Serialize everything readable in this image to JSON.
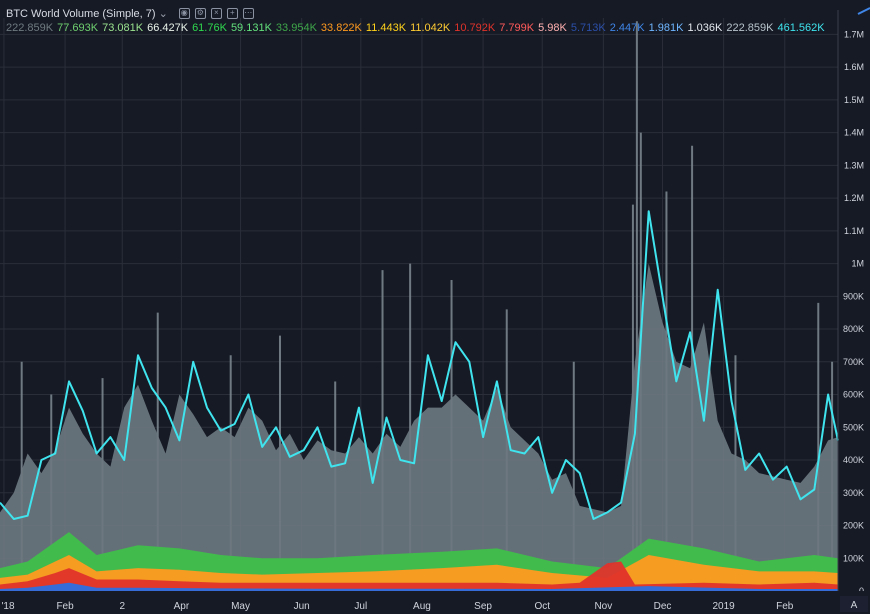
{
  "legend": {
    "title": "BTC World Volume (Simple, 7)",
    "chevron": "⌄",
    "buttons": [
      {
        "icon": "eye-icon",
        "glyph": "◉"
      },
      {
        "icon": "settings-icon",
        "glyph": "⚙"
      },
      {
        "icon": "remove-icon",
        "glyph": "×"
      },
      {
        "icon": "add-icon",
        "glyph": "+"
      },
      {
        "icon": "more-icon",
        "glyph": "⋯"
      }
    ],
    "values": [
      {
        "text": "222.859K",
        "color": "#6f7a80"
      },
      {
        "text": "77.693K",
        "color": "#6fcf6f"
      },
      {
        "text": "73.081K",
        "color": "#9be38f"
      },
      {
        "text": "66.427K",
        "color": "#e8f2e8"
      },
      {
        "text": "61.76K",
        "color": "#2fd94f"
      },
      {
        "text": "59.131K",
        "color": "#63e07c"
      },
      {
        "text": "33.954K",
        "color": "#3fa64a"
      },
      {
        "text": "33.822K",
        "color": "#ff9a1f"
      },
      {
        "text": "11.443K",
        "color": "#ffd21a"
      },
      {
        "text": "11.042K",
        "color": "#ffcc33"
      },
      {
        "text": "10.792K",
        "color": "#e0332b"
      },
      {
        "text": "7.799K",
        "color": "#ff5a5a"
      },
      {
        "text": "5.98K",
        "color": "#ffb0b0"
      },
      {
        "text": "5.713K",
        "color": "#2b4fa8"
      },
      {
        "text": "2.447K",
        "color": "#3f86e8"
      },
      {
        "text": "1.981K",
        "color": "#6fb6ff"
      },
      {
        "text": "1.036K",
        "color": "#e4e8ee"
      },
      {
        "text": "222.859K",
        "color": "#b8c4cc"
      },
      {
        "text": "461.562K",
        "color": "#3fe4ee"
      }
    ]
  },
  "colors": {
    "background": "#161a25",
    "grid": "#2a2e39",
    "total_area": "#6b777f",
    "moving_average": "#3fe4ee",
    "spikes": "#7e8a92"
  },
  "chart_data": {
    "type": "area",
    "title": "BTC World Volume (Simple, 7)",
    "xlabel": "",
    "ylabel": "",
    "ylim": [
      0,
      1750000
    ],
    "grid": true,
    "y_ticks": [
      "0",
      "100K",
      "200K",
      "300K",
      "400K",
      "500K",
      "600K",
      "700K",
      "800K",
      "900K",
      "1M",
      "1.1M",
      "1.2M",
      "1.3M",
      "1.4M",
      "1.5M",
      "1.6M",
      "1.7M"
    ],
    "x_ticks": [
      {
        "label": "'18",
        "x": "2018-01-01"
      },
      {
        "label": "Feb",
        "x": "2018-02-01"
      },
      {
        "label": "2",
        "x": "2018-03-02"
      },
      {
        "label": "Apr",
        "x": "2018-04-01"
      },
      {
        "label": "May",
        "x": "2018-05-01"
      },
      {
        "label": "Jun",
        "x": "2018-06-01"
      },
      {
        "label": "Jul",
        "x": "2018-07-01"
      },
      {
        "label": "Aug",
        "x": "2018-08-01"
      },
      {
        "label": "Sep",
        "x": "2018-09-01"
      },
      {
        "label": "Oct",
        "x": "2018-10-01"
      },
      {
        "label": "Nov",
        "x": "2018-11-01"
      },
      {
        "label": "Dec",
        "x": "2018-12-01"
      },
      {
        "label": "2019",
        "x": "2019-01-01"
      },
      {
        "label": "Feb",
        "x": "2019-02-01"
      }
    ],
    "x_range": [
      "2017-12-30",
      "2019-02-28"
    ],
    "series": [
      {
        "name": "",
        "role": "total",
        "values": [
          [
            "2017-12-30",
            240000
          ],
          [
            "2018-01-06",
            300000
          ],
          [
            "2018-01-13",
            420000
          ],
          [
            "2018-01-20",
            360000
          ],
          [
            "2018-01-27",
            430000
          ],
          [
            "2018-02-03",
            560000
          ],
          [
            "2018-02-10",
            480000
          ],
          [
            "2018-02-17",
            420000
          ],
          [
            "2018-02-24",
            380000
          ],
          [
            "2018-03-03",
            560000
          ],
          [
            "2018-03-10",
            630000
          ],
          [
            "2018-03-17",
            520000
          ],
          [
            "2018-03-24",
            420000
          ],
          [
            "2018-03-31",
            600000
          ],
          [
            "2018-04-07",
            540000
          ],
          [
            "2018-04-14",
            470000
          ],
          [
            "2018-04-21",
            500000
          ],
          [
            "2018-04-28",
            470000
          ],
          [
            "2018-05-05",
            560000
          ],
          [
            "2018-05-12",
            520000
          ],
          [
            "2018-05-19",
            430000
          ],
          [
            "2018-05-26",
            480000
          ],
          [
            "2018-06-02",
            400000
          ],
          [
            "2018-06-09",
            460000
          ],
          [
            "2018-06-16",
            430000
          ],
          [
            "2018-06-23",
            420000
          ],
          [
            "2018-06-30",
            470000
          ],
          [
            "2018-07-07",
            420000
          ],
          [
            "2018-07-14",
            480000
          ],
          [
            "2018-07-21",
            440000
          ],
          [
            "2018-07-28",
            520000
          ],
          [
            "2018-08-04",
            560000
          ],
          [
            "2018-08-11",
            560000
          ],
          [
            "2018-08-18",
            600000
          ],
          [
            "2018-08-25",
            560000
          ],
          [
            "2018-09-01",
            520000
          ],
          [
            "2018-09-08",
            620000
          ],
          [
            "2018-09-15",
            500000
          ],
          [
            "2018-09-22",
            460000
          ],
          [
            "2018-09-29",
            420000
          ],
          [
            "2018-10-06",
            340000
          ],
          [
            "2018-10-13",
            360000
          ],
          [
            "2018-10-20",
            260000
          ],
          [
            "2018-10-27",
            250000
          ],
          [
            "2018-11-03",
            240000
          ],
          [
            "2018-11-10",
            260000
          ],
          [
            "2018-11-17",
            700000
          ],
          [
            "2018-11-24",
            1000000
          ],
          [
            "2018-12-01",
            820000
          ],
          [
            "2018-12-08",
            700000
          ],
          [
            "2018-12-15",
            680000
          ],
          [
            "2018-12-22",
            820000
          ],
          [
            "2018-12-29",
            520000
          ],
          [
            "2019-01-05",
            420000
          ],
          [
            "2019-01-12",
            400000
          ],
          [
            "2019-01-19",
            360000
          ],
          [
            "2019-01-26",
            350000
          ],
          [
            "2019-02-02",
            340000
          ],
          [
            "2019-02-09",
            330000
          ],
          [
            "2019-02-16",
            380000
          ],
          [
            "2019-02-23",
            460000
          ],
          [
            "2019-02-28",
            470000
          ]
        ]
      },
      {
        "name": "",
        "role": "moving-average",
        "values": [
          [
            "2017-12-30",
            270000
          ],
          [
            "2018-01-06",
            220000
          ],
          [
            "2018-01-13",
            230000
          ],
          [
            "2018-01-20",
            400000
          ],
          [
            "2018-01-27",
            420000
          ],
          [
            "2018-02-03",
            640000
          ],
          [
            "2018-02-10",
            550000
          ],
          [
            "2018-02-17",
            420000
          ],
          [
            "2018-02-24",
            470000
          ],
          [
            "2018-03-03",
            400000
          ],
          [
            "2018-03-10",
            720000
          ],
          [
            "2018-03-17",
            620000
          ],
          [
            "2018-03-24",
            560000
          ],
          [
            "2018-03-31",
            460000
          ],
          [
            "2018-04-07",
            700000
          ],
          [
            "2018-04-14",
            560000
          ],
          [
            "2018-04-21",
            490000
          ],
          [
            "2018-04-28",
            510000
          ],
          [
            "2018-05-05",
            600000
          ],
          [
            "2018-05-12",
            440000
          ],
          [
            "2018-05-19",
            500000
          ],
          [
            "2018-05-26",
            410000
          ],
          [
            "2018-06-02",
            430000
          ],
          [
            "2018-06-09",
            500000
          ],
          [
            "2018-06-16",
            380000
          ],
          [
            "2018-06-23",
            390000
          ],
          [
            "2018-06-30",
            560000
          ],
          [
            "2018-07-07",
            330000
          ],
          [
            "2018-07-14",
            530000
          ],
          [
            "2018-07-21",
            400000
          ],
          [
            "2018-07-28",
            390000
          ],
          [
            "2018-08-04",
            720000
          ],
          [
            "2018-08-11",
            580000
          ],
          [
            "2018-08-18",
            760000
          ],
          [
            "2018-08-25",
            700000
          ],
          [
            "2018-09-01",
            470000
          ],
          [
            "2018-09-08",
            640000
          ],
          [
            "2018-09-15",
            430000
          ],
          [
            "2018-09-22",
            420000
          ],
          [
            "2018-09-29",
            470000
          ],
          [
            "2018-10-06",
            300000
          ],
          [
            "2018-10-13",
            400000
          ],
          [
            "2018-10-20",
            360000
          ],
          [
            "2018-10-27",
            220000
          ],
          [
            "2018-11-03",
            240000
          ],
          [
            "2018-11-10",
            270000
          ],
          [
            "2018-11-17",
            480000
          ],
          [
            "2018-11-24",
            1160000
          ],
          [
            "2018-12-01",
            900000
          ],
          [
            "2018-12-08",
            640000
          ],
          [
            "2018-12-15",
            790000
          ],
          [
            "2018-12-22",
            520000
          ],
          [
            "2018-12-29",
            920000
          ],
          [
            "2019-01-05",
            580000
          ],
          [
            "2019-01-12",
            370000
          ],
          [
            "2019-01-19",
            420000
          ],
          [
            "2019-01-26",
            340000
          ],
          [
            "2019-02-02",
            380000
          ],
          [
            "2019-02-09",
            280000
          ],
          [
            "2019-02-16",
            310000
          ],
          [
            "2019-02-23",
            600000
          ],
          [
            "2019-02-28",
            460000
          ]
        ]
      },
      {
        "name": "",
        "role": "green-band",
        "values": [
          [
            "2017-12-30",
            70000
          ],
          [
            "2018-01-13",
            90000
          ],
          [
            "2018-01-27",
            150000
          ],
          [
            "2018-02-03",
            180000
          ],
          [
            "2018-02-17",
            110000
          ],
          [
            "2018-03-10",
            140000
          ],
          [
            "2018-03-31",
            130000
          ],
          [
            "2018-04-21",
            110000
          ],
          [
            "2018-05-12",
            100000
          ],
          [
            "2018-06-09",
            100000
          ],
          [
            "2018-07-07",
            110000
          ],
          [
            "2018-08-11",
            120000
          ],
          [
            "2018-09-08",
            130000
          ],
          [
            "2018-10-06",
            90000
          ],
          [
            "2018-11-03",
            70000
          ],
          [
            "2018-11-24",
            160000
          ],
          [
            "2018-12-22",
            130000
          ],
          [
            "2019-01-19",
            90000
          ],
          [
            "2019-02-16",
            110000
          ],
          [
            "2019-02-28",
            100000
          ]
        ]
      },
      {
        "name": "",
        "role": "orange-band",
        "values": [
          [
            "2017-12-30",
            40000
          ],
          [
            "2018-01-13",
            50000
          ],
          [
            "2018-01-27",
            90000
          ],
          [
            "2018-02-03",
            110000
          ],
          [
            "2018-02-17",
            60000
          ],
          [
            "2018-03-10",
            70000
          ],
          [
            "2018-03-31",
            65000
          ],
          [
            "2018-04-21",
            55000
          ],
          [
            "2018-05-12",
            50000
          ],
          [
            "2018-06-09",
            55000
          ],
          [
            "2018-07-07",
            60000
          ],
          [
            "2018-08-11",
            70000
          ],
          [
            "2018-09-08",
            80000
          ],
          [
            "2018-10-06",
            55000
          ],
          [
            "2018-11-03",
            40000
          ],
          [
            "2018-11-24",
            110000
          ],
          [
            "2018-12-22",
            80000
          ],
          [
            "2019-01-19",
            60000
          ],
          [
            "2019-02-16",
            60000
          ],
          [
            "2019-02-28",
            55000
          ]
        ]
      },
      {
        "name": "",
        "role": "red-band",
        "values": [
          [
            "2017-12-30",
            20000
          ],
          [
            "2018-01-13",
            30000
          ],
          [
            "2018-01-27",
            55000
          ],
          [
            "2018-02-03",
            70000
          ],
          [
            "2018-02-17",
            35000
          ],
          [
            "2018-03-10",
            35000
          ],
          [
            "2018-03-31",
            30000
          ],
          [
            "2018-04-21",
            25000
          ],
          [
            "2018-05-12",
            25000
          ],
          [
            "2018-06-09",
            25000
          ],
          [
            "2018-07-07",
            25000
          ],
          [
            "2018-08-11",
            25000
          ],
          [
            "2018-09-08",
            25000
          ],
          [
            "2018-10-06",
            20000
          ],
          [
            "2018-10-20",
            25000
          ],
          [
            "2018-11-03",
            85000
          ],
          [
            "2018-11-10",
            90000
          ],
          [
            "2018-11-17",
            20000
          ],
          [
            "2018-12-22",
            25000
          ],
          [
            "2019-01-19",
            20000
          ],
          [
            "2019-02-16",
            25000
          ],
          [
            "2019-02-28",
            20000
          ]
        ]
      },
      {
        "name": "",
        "role": "blue-band",
        "values": [
          [
            "2017-12-30",
            6000
          ],
          [
            "2018-01-13",
            10000
          ],
          [
            "2018-01-27",
            20000
          ],
          [
            "2018-02-03",
            25000
          ],
          [
            "2018-02-17",
            10000
          ],
          [
            "2018-03-10",
            10000
          ],
          [
            "2018-04-21",
            8000
          ],
          [
            "2018-06-09",
            7000
          ],
          [
            "2018-08-11",
            7000
          ],
          [
            "2018-10-06",
            6000
          ],
          [
            "2018-11-24",
            15000
          ],
          [
            "2019-01-19",
            6000
          ],
          [
            "2019-02-28",
            6000
          ]
        ]
      }
    ],
    "spikes": [
      [
        "2018-01-10",
        700000
      ],
      [
        "2018-01-25",
        600000
      ],
      [
        "2018-02-20",
        650000
      ],
      [
        "2018-03-20",
        850000
      ],
      [
        "2018-04-26",
        720000
      ],
      [
        "2018-05-21",
        780000
      ],
      [
        "2018-06-18",
        640000
      ],
      [
        "2018-07-12",
        980000
      ],
      [
        "2018-07-26",
        1000000
      ],
      [
        "2018-08-16",
        950000
      ],
      [
        "2018-09-13",
        860000
      ],
      [
        "2018-10-17",
        700000
      ],
      [
        "2018-11-16",
        1180000
      ],
      [
        "2018-11-18",
        1740000
      ],
      [
        "2018-11-20",
        1400000
      ],
      [
        "2018-12-03",
        1220000
      ],
      [
        "2018-12-16",
        1360000
      ],
      [
        "2019-01-07",
        720000
      ],
      [
        "2019-02-18",
        880000
      ],
      [
        "2019-02-25",
        700000
      ]
    ]
  }
}
